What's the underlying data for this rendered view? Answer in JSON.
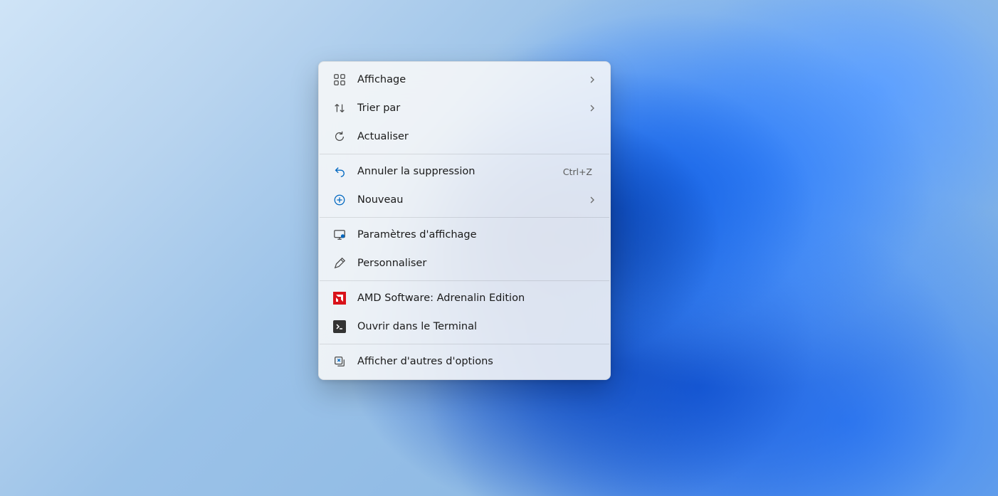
{
  "context_menu": {
    "items": {
      "view": {
        "label": "Affichage",
        "has_submenu": true
      },
      "sort": {
        "label": "Trier par",
        "has_submenu": true
      },
      "refresh": {
        "label": "Actualiser"
      },
      "undo": {
        "label": "Annuler la suppression",
        "shortcut": "Ctrl+Z"
      },
      "new": {
        "label": "Nouveau",
        "has_submenu": true
      },
      "display": {
        "label": "Paramètres d'affichage"
      },
      "personalize": {
        "label": "Personnaliser"
      },
      "amd": {
        "label": "AMD Software: Adrenalin Edition"
      },
      "terminal": {
        "label": "Ouvrir dans le Terminal"
      },
      "more": {
        "label": "Afficher d'autres d'options"
      }
    }
  }
}
